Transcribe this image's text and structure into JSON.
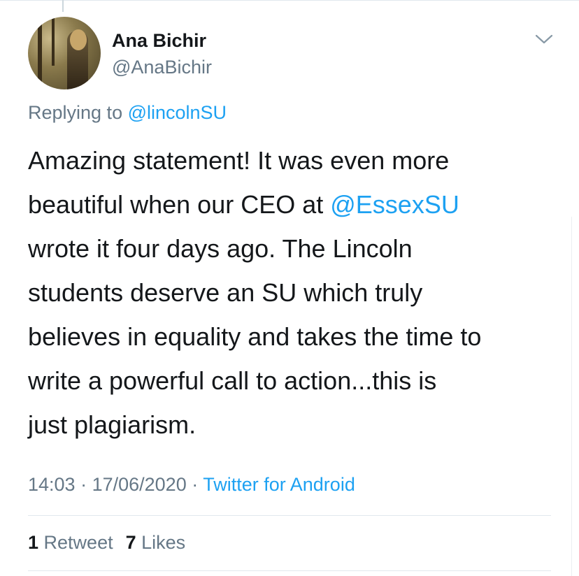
{
  "tweet": {
    "author": {
      "name": "Ana Bichir",
      "handle": "@AnaBichir"
    },
    "reply": {
      "prefix": "Replying to ",
      "to": "@lincolnSU"
    },
    "body": {
      "line1": "Amazing statement! It was even more",
      "line2_before": "beautiful when our CEO at ",
      "line2_mention": "@EssexSU",
      "line3": "wrote it four days ago. The Lincoln",
      "line4": "students deserve an SU which truly",
      "line5": "believes in equality and takes the time to",
      "line6": "write a powerful call to action...this is",
      "line7": "just plagiarism."
    },
    "meta": {
      "time": "14:03",
      "separator1": " · ",
      "date": "17/06/2020",
      "separator2": " · ",
      "source": "Twitter for Android"
    },
    "stats": {
      "retweets_count": "1",
      "retweets_label": " Retweet",
      "likes_count": "7",
      "likes_label": " Likes"
    }
  },
  "icons": {
    "menu": "chevron-down-icon"
  },
  "colors": {
    "text": "#14171a",
    "secondary": "#657786",
    "link": "#1da1f2",
    "divider": "#e1e8ed"
  }
}
